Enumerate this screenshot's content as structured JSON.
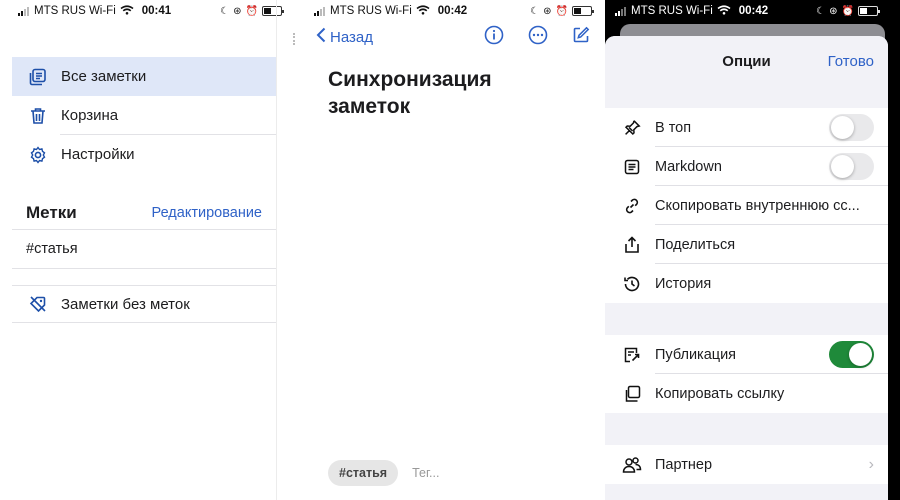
{
  "status_left": {
    "carrier": "MTS RUS Wi-Fi",
    "time": "00:41"
  },
  "status_mid": {
    "carrier": "MTS RUS Wi-Fi",
    "time": "00:42"
  },
  "status_right": {
    "carrier": "MTS RUS Wi-Fi",
    "time": "00:42"
  },
  "sidebar": {
    "items": [
      {
        "label": "Все заметки",
        "icon": "notes-stack-icon",
        "active": true
      },
      {
        "label": "Корзина",
        "icon": "trash-icon",
        "active": false
      },
      {
        "label": "Настройки",
        "icon": "gear-icon",
        "active": false
      }
    ],
    "tags_title": "Метки",
    "tags_edit": "Редактирование",
    "tags": [
      "#статья"
    ],
    "untagged_label": "Заметки без меток"
  },
  "note": {
    "back_label": "Назад",
    "title": "Синхронизация заметок",
    "tag_chip": "#статья",
    "tag_placeholder": "Тег..."
  },
  "options": {
    "title": "Опции",
    "done": "Готово",
    "group1": [
      {
        "label": "В топ",
        "icon": "pin-icon",
        "control": "toggle",
        "on": false
      },
      {
        "label": "Markdown",
        "icon": "document-icon",
        "control": "toggle",
        "on": false
      },
      {
        "label": "Скопировать внутреннюю сс...",
        "icon": "link-icon",
        "control": "none"
      },
      {
        "label": "Поделиться",
        "icon": "share-icon",
        "control": "none"
      },
      {
        "label": "История",
        "icon": "history-icon",
        "control": "none"
      }
    ],
    "group2": [
      {
        "label": "Публикация",
        "icon": "publish-icon",
        "control": "toggle",
        "on": true
      },
      {
        "label": "Копировать ссылку",
        "icon": "copy-icon",
        "control": "none"
      }
    ],
    "group3": [
      {
        "label": "Партнер",
        "icon": "partner-icon",
        "control": "chevron"
      }
    ]
  },
  "colors": {
    "accent": "#2f62c7",
    "active_bg": "#dfe7f8",
    "toggle_on": "#1f8a3a"
  }
}
